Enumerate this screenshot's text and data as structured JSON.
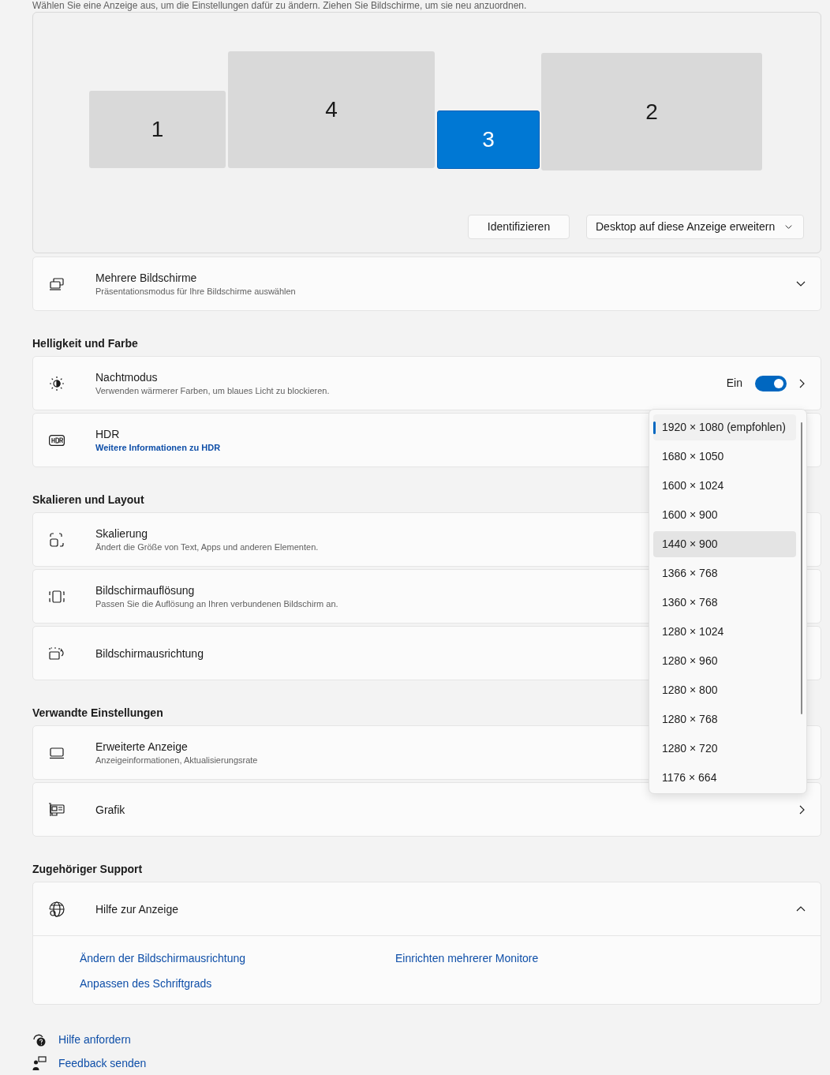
{
  "intro": "Wählen Sie eine Anzeige aus, um die Einstellungen dafür zu ändern. Ziehen Sie Bildschirme, um sie neu anzuordnen.",
  "monitors": [
    {
      "label": "1",
      "selected": false
    },
    {
      "label": "4",
      "selected": false
    },
    {
      "label": "3",
      "selected": true
    },
    {
      "label": "2",
      "selected": false
    }
  ],
  "identify_button": "Identifizieren",
  "mode_dropdown": "Desktop auf diese Anzeige erweitern",
  "sections": [
    {
      "rows": [
        {
          "kind": "expander",
          "title": "Mehrere Bildschirme",
          "subtitle": "Präsentationsmodus für Ihre Bildschirme auswählen",
          "expanded": false
        }
      ]
    },
    {
      "heading": "Helligkeit und Farbe",
      "rows": [
        {
          "kind": "toggle_link",
          "title": "Nachtmodus",
          "subtitle": "Verwenden wärmerer Farben, um blaues Licht zu blockieren.",
          "toggle_label": "Ein",
          "on": true
        },
        {
          "kind": "plain",
          "title": "HDR",
          "link": "Weitere Informationen zu HDR"
        }
      ]
    },
    {
      "heading": "Skalieren und Layout",
      "rows": [
        {
          "kind": "plain",
          "title": "Skalierung",
          "subtitle": "Ändert die Größe von Text, Apps und anderen Elementen."
        },
        {
          "kind": "plain",
          "title": "Bildschirmauflösung",
          "subtitle": "Passen Sie die Auflösung an Ihren verbundenen Bildschirm an."
        },
        {
          "kind": "plain",
          "title": "Bildschirmausrichtung"
        }
      ]
    },
    {
      "heading": "Verwandte Einstellungen",
      "rows": [
        {
          "kind": "plain",
          "title": "Erweiterte Anzeige",
          "subtitle": "Anzeigeinformationen, Aktualisierungsrate"
        },
        {
          "kind": "link",
          "title": "Grafik"
        }
      ]
    },
    {
      "heading": "Zugehöriger Support",
      "rows": [
        {
          "kind": "expander",
          "title": "Hilfe zur Anzeige",
          "expanded": true,
          "links": [
            "Ändern der Bildschirmausrichtung",
            "Einrichten mehrerer Monitore",
            "Anpassen des Schriftgrads"
          ]
        }
      ]
    }
  ],
  "footer_links": [
    "Hilfe anfordern",
    "Feedback senden"
  ],
  "resolution_list": [
    {
      "label": "1920 × 1080 (empfohlen)",
      "selected": true,
      "hovered": false
    },
    {
      "label": "1680 × 1050",
      "selected": false,
      "hovered": false
    },
    {
      "label": "1600 × 1024",
      "selected": false,
      "hovered": false
    },
    {
      "label": "1600 × 900",
      "selected": false,
      "hovered": false
    },
    {
      "label": "1440 × 900",
      "selected": false,
      "hovered": true
    },
    {
      "label": "1366 × 768",
      "selected": false,
      "hovered": false
    },
    {
      "label": "1360 × 768",
      "selected": false,
      "hovered": false
    },
    {
      "label": "1280 × 1024",
      "selected": false,
      "hovered": false
    },
    {
      "label": "1280 × 960",
      "selected": false,
      "hovered": false
    },
    {
      "label": "1280 × 800",
      "selected": false,
      "hovered": false
    },
    {
      "label": "1280 × 768",
      "selected": false,
      "hovered": false
    },
    {
      "label": "1280 × 720",
      "selected": false,
      "hovered": false
    },
    {
      "label": "1176 × 664",
      "selected": false,
      "hovered": false
    }
  ]
}
